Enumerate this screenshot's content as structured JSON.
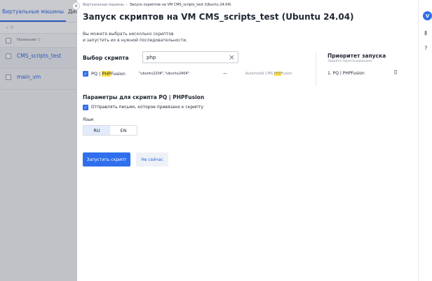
{
  "background": {
    "tabs": [
      "Виртуальные машины",
      "Диски"
    ],
    "header_label": "Название",
    "filter_icon": "filter-icon",
    "rows": [
      "CMS_scripts_test",
      "main_vm"
    ],
    "toolbar_count": "0"
  },
  "rail": {
    "avatar_letter": "V",
    "icons": [
      "book-icon",
      "help-icon"
    ]
  },
  "drawer": {
    "breadcrumbs": [
      "Виртуальные машины",
      "Запуск скриптов на VM CMS_scripts_test (Ubuntu 24.04)"
    ],
    "title": "Запуск скриптов на VM CMS_scripts_test (Ubuntu 24.04)",
    "description_line1": "Вы можете выбрать несколько скриптов",
    "description_line2": "и запустить их в нужной последовательности.",
    "select_label": "Выбор скрипта",
    "search": {
      "value": "php"
    },
    "script": {
      "name_prefix": "PQ | ",
      "name_highlight": "PHP",
      "name_suffix": "Fusion",
      "os": "\"ubuntu2204\",\"ubuntu2404\"",
      "dash": "—",
      "desc_prefix": "Autoinstall CMS ",
      "desc_highlight": "PHP",
      "desc_suffix": "Fusion"
    },
    "priority": {
      "title": "Приоритет запуска",
      "subtitle": "Задайте перетаскиванием",
      "items": [
        "1. PQ | PHPFusion"
      ]
    },
    "params_title": "Параметры для скрипта PQ | PHPFusion",
    "send_mail_label": "Отправлять письмо, которое привязано к скрипту",
    "language_label": "Язык",
    "languages": [
      "RU",
      "EN"
    ],
    "selected_language": "RU",
    "run_button": "Запустить скрипт",
    "later_button": "Не сейчас"
  },
  "colors": {
    "accent": "#2f6fed",
    "highlight": "#fde047"
  }
}
